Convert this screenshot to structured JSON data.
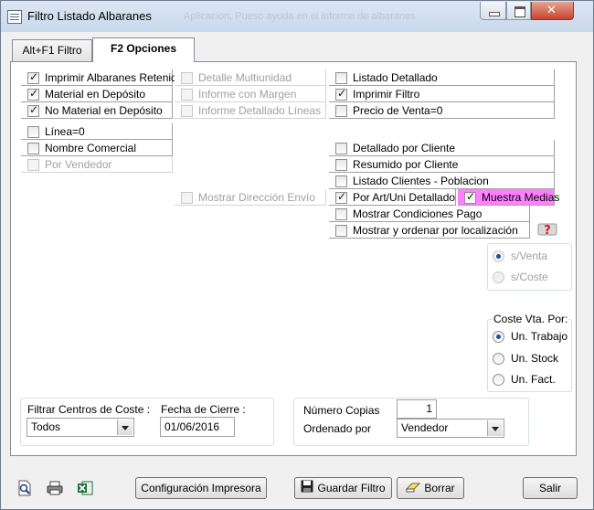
{
  "window": {
    "title": "Filtro Listado Albaranes",
    "ghost_title": "Aplicacion, Pueso ayuda en el informe de albaranes"
  },
  "tabs": [
    {
      "label": "Alt+F1 Filtro"
    },
    {
      "label": "F2 Opciones"
    }
  ],
  "options": {
    "col1": [
      {
        "label": "Imprimir Albaranes Retenidos",
        "checked": true
      },
      {
        "label": "Material en Depósito",
        "checked": true
      },
      {
        "label": "No Material en Depósito",
        "checked": true
      }
    ],
    "col2": [
      {
        "label": "Detalle Multiunidad",
        "checked": false
      },
      {
        "label": "Informe con Margen",
        "checked": false
      },
      {
        "label": "Informe Detallado Líneas",
        "checked": false
      }
    ],
    "col3": [
      {
        "label": "Listado Detallado",
        "checked": false
      },
      {
        "label": "Imprimir Filtro",
        "checked": true
      },
      {
        "label": "Precio de Venta=0",
        "checked": false
      }
    ],
    "col1b": [
      {
        "label": "Línea=0",
        "checked": false
      },
      {
        "label": "Nombre Comercial",
        "checked": false
      },
      {
        "label": "Por Vendedor",
        "checked": false
      }
    ],
    "mostrar_direccion": {
      "label": "Mostrar Dirección Envío",
      "checked": false
    },
    "col3b": [
      {
        "label": "Detallado por Cliente",
        "checked": false
      },
      {
        "label": "Resumido por Cliente",
        "checked": false
      },
      {
        "label": "Listado Clientes - Poblacion",
        "checked": false
      },
      {
        "label": "Por Art/Uni Detallado",
        "checked": true
      },
      {
        "label": "Mostrar Condiciones Pago",
        "checked": false
      },
      {
        "label": "Mostrar y ordenar por localización",
        "checked": false
      }
    ],
    "muestra_medias": {
      "label": "Muestra Medias",
      "checked": true
    }
  },
  "venta_group": {
    "options": [
      {
        "label": "s/Venta",
        "selected": true
      },
      {
        "label": "s/Coste",
        "selected": false
      }
    ]
  },
  "coste_group": {
    "title": "Coste Vta. Por:",
    "options": [
      {
        "label": "Un. Trabajo",
        "selected": true
      },
      {
        "label": "Un. Stock",
        "selected": false
      },
      {
        "label": "Un. Fact.",
        "selected": false
      }
    ]
  },
  "filtrar": {
    "label": "Filtrar Centros de Coste :",
    "value": "Todos"
  },
  "fecha": {
    "label": "Fecha de Cierre :",
    "value": "01/06/2016"
  },
  "copias": {
    "label": "Número Copias",
    "value": "1"
  },
  "ordenado": {
    "label": "Ordenado por",
    "value": "Vendedor"
  },
  "buttons": {
    "config": "Configuración Impresora",
    "guardar": "Guardar Filtro",
    "borrar": "Borrar",
    "salir": "Salir"
  },
  "icons": {
    "preview": "print-preview-icon",
    "print": "printer-icon",
    "excel": "excel-icon",
    "help": "help-icon"
  }
}
